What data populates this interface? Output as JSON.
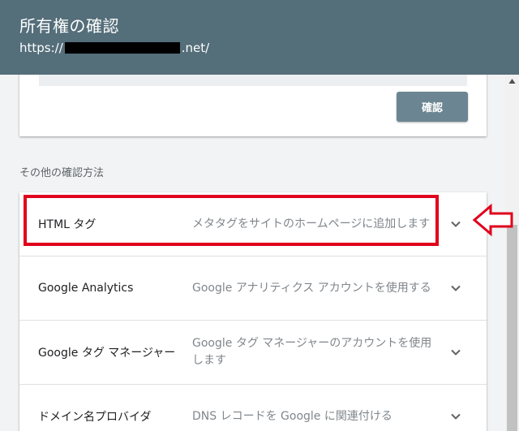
{
  "header": {
    "title": "所有権の確認",
    "url_prefix": "https://",
    "url_suffix": ".net/"
  },
  "verify_card": {
    "verify_button_label": "確認"
  },
  "other_methods": {
    "section_label": "その他の確認方法",
    "items": [
      {
        "name": "HTML タグ",
        "description": "メタタグをサイトのホームページに追加します"
      },
      {
        "name": "Google Analytics",
        "description": "Google アナリティクス アカウントを使用する"
      },
      {
        "name": "Google タグ マネージャー",
        "description": "Google タグ マネージャーのアカウントを使用します"
      },
      {
        "name": "ドメイン名プロバイダ",
        "description": "DNS レコードを Google に関連付ける"
      }
    ]
  },
  "icons": {
    "expand": "chevron-down-icon",
    "annotation": "left-arrow-icon",
    "scroll": "scroll-up-icon"
  },
  "colors": {
    "header_bg": "#546e7a",
    "button_bg": "#6c8592",
    "highlight": "#e0001b"
  }
}
